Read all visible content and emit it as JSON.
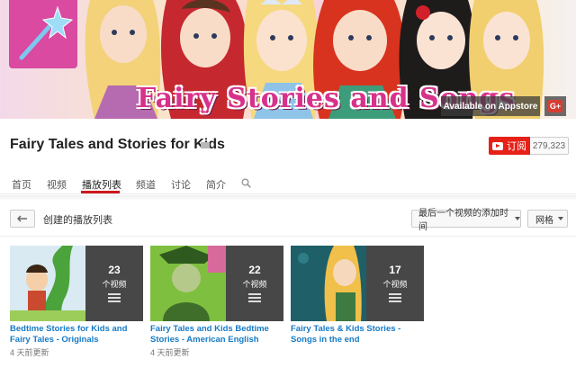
{
  "banner": {
    "title": "Fairy Stories and Songs",
    "appstore_link": "Available on Appstore",
    "gplus_label": "G+"
  },
  "channel": {
    "name": "Fairy Tales and Stories for Kids",
    "subscribe_label": "订阅",
    "subscriber_count": "279,323"
  },
  "tabs": [
    {
      "label": "首页"
    },
    {
      "label": "视频"
    },
    {
      "label": "播放列表",
      "active": true
    },
    {
      "label": "频道"
    },
    {
      "label": "讨论"
    },
    {
      "label": "简介"
    }
  ],
  "toolbar": {
    "section_title": "创建的播放列表",
    "sort_label": "最后一个视频的添加时间",
    "view_label": "网格"
  },
  "playlists": [
    {
      "count": "23",
      "count_label": "个视频",
      "title": "Bedtime Stories for Kids and Fairy Tales - Originals",
      "updated": "4 天前更新"
    },
    {
      "count": "22",
      "count_label": "个视频",
      "title": "Fairy Tales and Kids Bedtime Stories - American English",
      "updated": "4 天前更新"
    },
    {
      "count": "17",
      "count_label": "个视频",
      "title": "Fairy Tales & Kids Stories - Songs in the end",
      "updated": ""
    }
  ],
  "colors": {
    "accent_red": "#cc181e",
    "subscribe_red": "#e62117",
    "link_blue": "#167ac6",
    "banner_pink": "#d8318b"
  }
}
